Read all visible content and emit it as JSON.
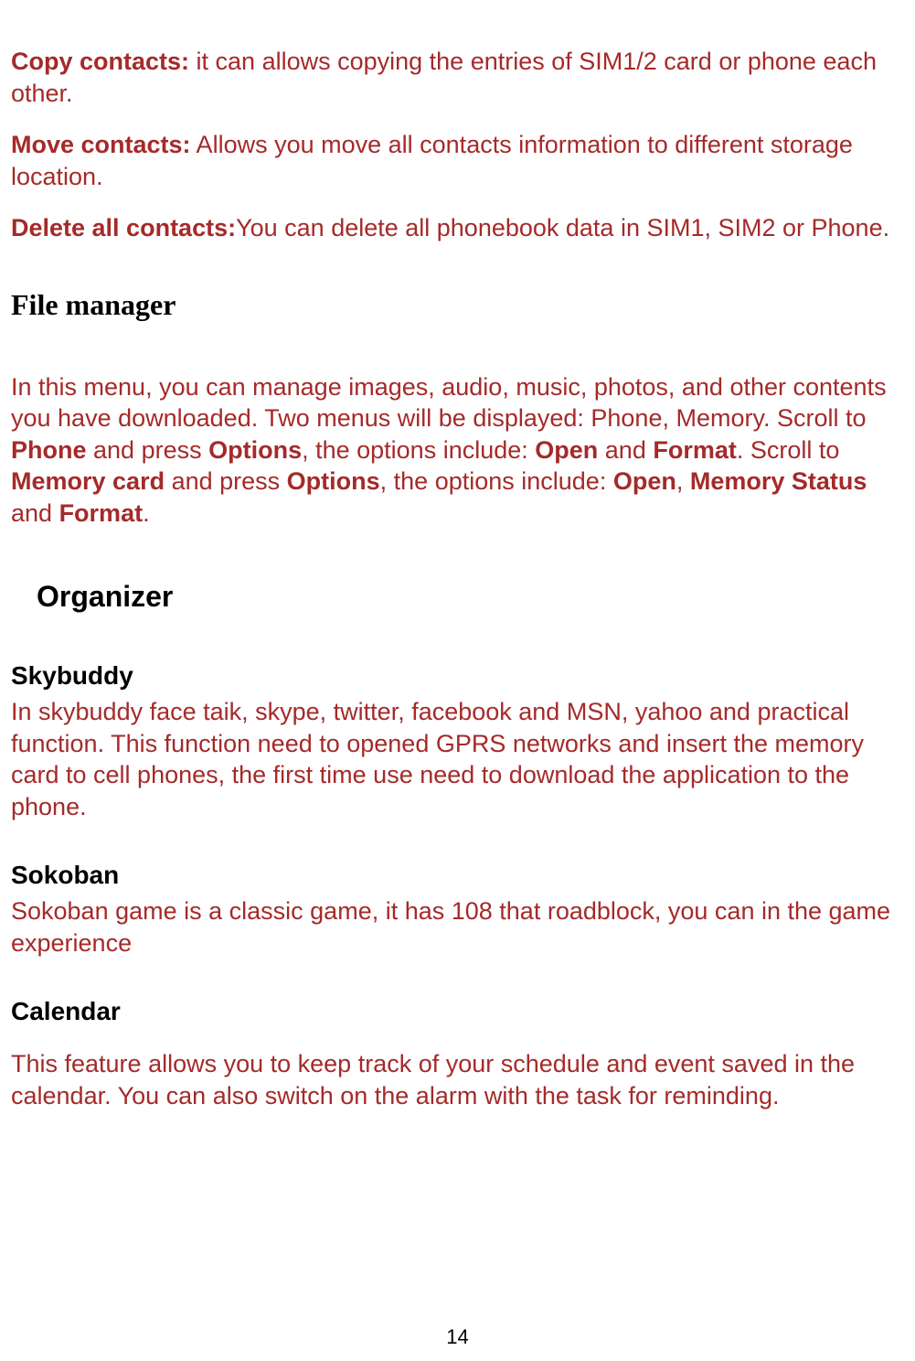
{
  "copy_contacts": {
    "label": "Copy contacts:",
    "text": " it can allows copying the entries of SIM1/2 card or phone each other."
  },
  "move_contacts": {
    "label": "Move contacts:",
    "text": " Allows you move all contacts information to different storage location."
  },
  "delete_all_contacts": {
    "label": "Delete all contacts:",
    "text": "You can delete all phonebook data in SIM1, SIM2 or Phone."
  },
  "file_manager": {
    "heading": "File manager",
    "p1_a": "In this menu, you can manage images, audio, music, photos, and other contents you have downloaded. Two menus will be displayed: Phone, Memory.  Scroll to ",
    "phone": "Phone",
    "p1_b": " and press ",
    "options1": "Options",
    "p1_c": ", the options include: ",
    "open1": "Open",
    "p1_d": " and ",
    "format1": "Format",
    "p1_e": ". Scroll to ",
    "memcard": "Memory card",
    "p1_f": " and press ",
    "options2": "Options",
    "p1_g": ", the options include: ",
    "open2": "Open",
    "p1_h": ", ",
    "memstatus": "Memory Status",
    "p1_i": " and ",
    "format2": "Format",
    "p1_j": "."
  },
  "organizer": {
    "heading": "Organizer",
    "skybuddy": {
      "heading": "Skybuddy",
      "text": "In skybuddy face taik, skype, twitter, facebook and MSN, yahoo and practical function. This function need to opened GPRS networks and insert the memory card to cell phones, the first time use need to download the application to the phone."
    },
    "sokoban": {
      "heading": "Sokoban",
      "text": "Sokoban game is a classic game, it has 108 that roadblock, you can in the game experience"
    },
    "calendar": {
      "heading": "Calendar",
      "text": "This feature allows you to keep track of your schedule and event saved in the calendar. You can also switch on the alarm with the task for reminding."
    }
  },
  "page_number": "14"
}
